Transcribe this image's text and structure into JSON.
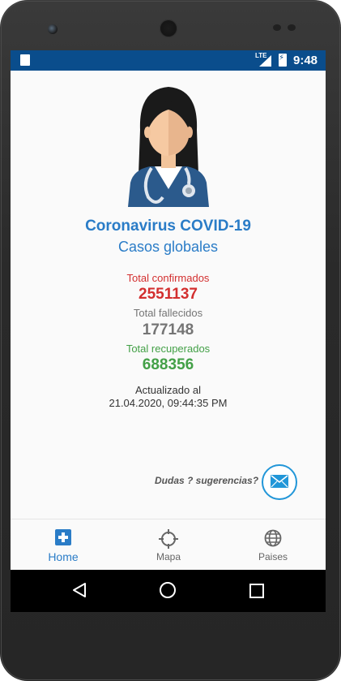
{
  "status_bar": {
    "network": "LTE",
    "time": "9:48"
  },
  "header": {
    "title": "Coronavirus COVID-19",
    "subtitle": "Casos globales"
  },
  "stats": {
    "confirmed": {
      "label": "Total confirmados",
      "value": "2551137"
    },
    "deaths": {
      "label": "Total fallecidos",
      "value": "177148"
    },
    "recovered": {
      "label": "Total recuperados",
      "value": "688356"
    }
  },
  "updated": {
    "line1": "Actualizado al",
    "line2": "21.04.2020, 09:44:35 PM"
  },
  "feedback": {
    "text": "Dudas ? sugerencias?",
    "icon": "mail-icon"
  },
  "bottom_nav": {
    "items": [
      {
        "label": "Home",
        "icon": "plus-box-icon",
        "active": true
      },
      {
        "label": "Mapa",
        "icon": "crosshair-icon",
        "active": false
      },
      {
        "label": "Paises",
        "icon": "globe-icon",
        "active": false
      }
    ]
  },
  "colors": {
    "status_bar": "#0a4d8c",
    "accent": "#2a7cc7",
    "confirmed": "#d32f2f",
    "deaths": "#757575",
    "recovered": "#43a047",
    "mail_button": "#2196d8"
  }
}
